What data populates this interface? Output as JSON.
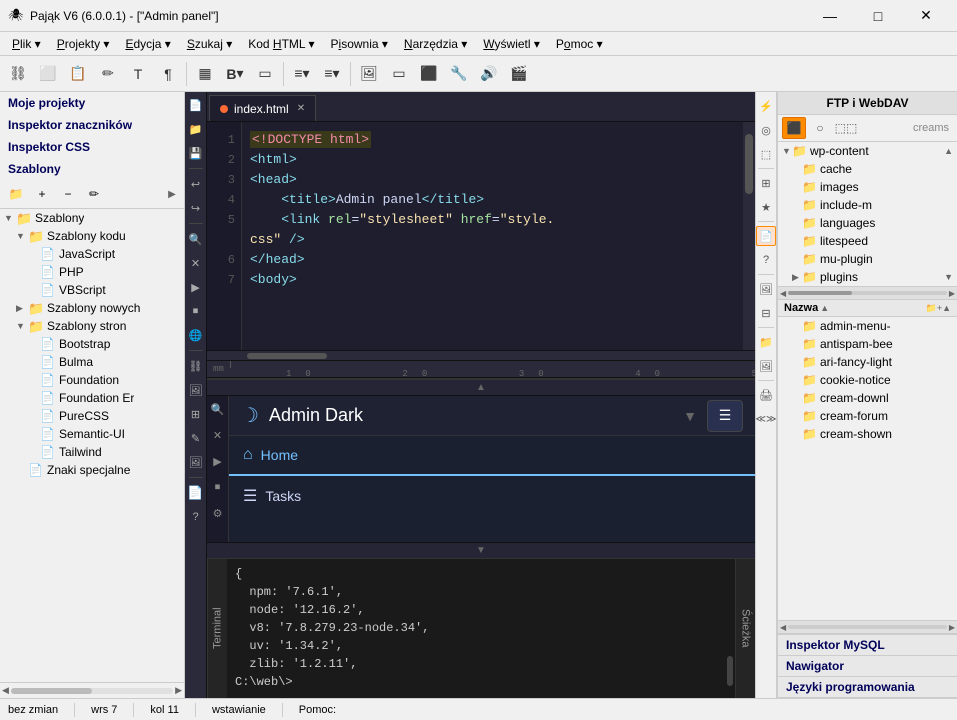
{
  "titleBar": {
    "icon": "🕷",
    "title": "Pająk V6 (6.0.0.1) - [\"Admin panel\"]",
    "minimize": "—",
    "maximize": "□",
    "close": "✕"
  },
  "menuBar": {
    "items": [
      {
        "label": "Plik",
        "underline": "P"
      },
      {
        "label": "Projekty",
        "underline": "P"
      },
      {
        "label": "Edycja",
        "underline": "E"
      },
      {
        "label": "Szukaj",
        "underline": "S"
      },
      {
        "label": "Kod HTML",
        "underline": "H"
      },
      {
        "label": "Pisownia",
        "underline": "i"
      },
      {
        "label": "Narzędzia",
        "underline": "N"
      },
      {
        "label": "Wyświetl",
        "underline": "W"
      },
      {
        "label": "Pomoc",
        "underline": "o"
      }
    ]
  },
  "leftSidebar": {
    "headers": [
      {
        "label": "Moje projekty"
      },
      {
        "label": "Inspektor znaczników"
      },
      {
        "label": "Inspektor CSS"
      },
      {
        "label": "Szablony"
      }
    ],
    "tree": {
      "root": "Szablony",
      "children": [
        {
          "label": "Szablony kodu",
          "expanded": true,
          "children": [
            {
              "label": "JavaScript"
            },
            {
              "label": "PHP"
            },
            {
              "label": "VBScript"
            }
          ]
        },
        {
          "label": "Szablony nowych",
          "expanded": false
        },
        {
          "label": "Szablony stron",
          "expanded": true,
          "children": [
            {
              "label": "Bootstrap"
            },
            {
              "label": "Bulma"
            },
            {
              "label": "Foundation"
            },
            {
              "label": "Foundation Er"
            },
            {
              "label": "PureCSS"
            },
            {
              "label": "Semantic-UI"
            },
            {
              "label": "Tailwind"
            }
          ]
        },
        {
          "label": "Znaki specjalne"
        }
      ]
    }
  },
  "editor": {
    "tab": {
      "filename": "index.html",
      "modified": true
    },
    "lines": [
      {
        "num": 1,
        "content_html": "<span class='hl-doctype'>&lt;!DOCTYPE html&gt;</span>"
      },
      {
        "num": 2,
        "content_html": "<span class='hl-tag'>&lt;html&gt;</span>"
      },
      {
        "num": 3,
        "content_html": "<span class='hl-tag'>&lt;head&gt;</span>"
      },
      {
        "num": 4,
        "content_html": "    <span class='hl-tag'>&lt;title&gt;</span><span class='hl-text'>Admin panel</span><span class='hl-tag'>&lt;/title&gt;</span>"
      },
      {
        "num": 5,
        "content_html": "    <span class='hl-tag'>&lt;link</span> <span class='hl-attr'>rel</span>=<span class='hl-val'>\"stylesheet\"</span> <span class='hl-attr'>href</span>=<span class='hl-val'>\"style.</span>"
      },
      {
        "num": 5,
        "content_html": "<span class='hl-val'>css\"</span> <span class='hl-punct'>/&gt;</span>"
      },
      {
        "num": 6,
        "content_html": "<span class='hl-tag'>&lt;/head&gt;</span>"
      },
      {
        "num": 7,
        "content_html": "<span class='hl-tag'>&lt;body&gt;</span>"
      }
    ]
  },
  "preview": {
    "title": "Admin Dark",
    "navItems": [
      {
        "label": "Home",
        "icon": "⌂",
        "active": true
      },
      {
        "label": "Tasks",
        "icon": "☰",
        "active": false
      }
    ]
  },
  "terminal": {
    "label": "Terminal",
    "pathLabel": "Ścieżka",
    "lines": [
      "npm: '7.6.1',",
      "node: '12.16.2',",
      "v8: '7.8.279.23-node.34',",
      "uv: '1.34.2',",
      "zlib: '1.2.11',",
      "C:\\web\\>"
    ],
    "openBrace": "{"
  },
  "ftpPanel": {
    "title": "FTP i WebDAV",
    "creamLabel": "creams",
    "folders": [
      {
        "label": "wp-content",
        "expanded": true
      },
      {
        "label": "cache",
        "expanded": false
      },
      {
        "label": "images",
        "expanded": false
      },
      {
        "label": "include-m",
        "expanded": false
      },
      {
        "label": "languages",
        "expanded": false
      },
      {
        "label": "litespeed",
        "expanded": false
      },
      {
        "label": "mu-plugin",
        "expanded": false
      },
      {
        "label": "plugins",
        "expanded": false
      }
    ],
    "folders2": [
      {
        "label": "admin-menu-",
        "expanded": false
      },
      {
        "label": "antispam-bee",
        "expanded": false
      },
      {
        "label": "ari-fancy-light",
        "expanded": false
      },
      {
        "label": "cookie-notice",
        "expanded": false
      },
      {
        "label": "cream-downl",
        "expanded": false
      },
      {
        "label": "cream-forum",
        "expanded": false
      },
      {
        "label": "cream-shown",
        "expanded": false
      }
    ],
    "bottomItems": [
      "Inspektor MySQL",
      "Nawigator",
      "Języki programowania"
    ],
    "nameLabel": "Nazwa"
  },
  "statusBar": {
    "status": "bez zmian",
    "wrs": "wrs 7",
    "kol": "kol 11",
    "mode": "wstawianie",
    "help": "Pomoc:"
  },
  "rightTools": {
    "buttons": [
      "⚡",
      "💾",
      "📋",
      "🔗",
      "🖼",
      "⚙",
      "☆",
      "📄",
      "?"
    ]
  }
}
